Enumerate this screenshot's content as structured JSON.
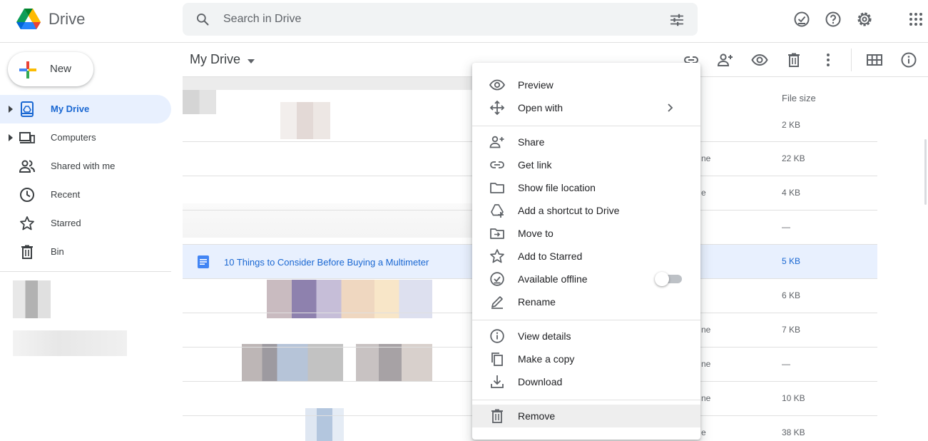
{
  "app": {
    "name": "Drive"
  },
  "search": {
    "placeholder": "Search in Drive"
  },
  "header_icons": [
    "offline-status-icon",
    "help-icon",
    "settings-icon",
    "apps-grid-icon"
  ],
  "sidebar": {
    "new_label": "New",
    "items": [
      {
        "label": "My Drive",
        "icon": "my-drive-icon",
        "active": true
      },
      {
        "label": "Computers",
        "icon": "computers-icon"
      },
      {
        "label": "Shared with me",
        "icon": "shared-icon"
      },
      {
        "label": "Recent",
        "icon": "clock-icon"
      },
      {
        "label": "Starred",
        "icon": "star-icon"
      },
      {
        "label": "Bin",
        "icon": "trash-icon"
      }
    ]
  },
  "main": {
    "breadcrumb": "My Drive",
    "toolbar_icons": [
      "link-icon",
      "add-person-icon",
      "preview-eye-icon",
      "trash-icon",
      "more-vert-icon",
      "grid-view-icon",
      "info-icon"
    ],
    "column_header": "File size",
    "selected_file": "10 Things to Consider Before Buying a Multimeter",
    "owner_fragments": [
      "ne",
      "e",
      "ne",
      "ne",
      "ne",
      "e"
    ],
    "file_sizes": [
      "2 KB",
      "22 KB",
      "4 KB",
      "—",
      "5 KB",
      "6 KB",
      "7 KB",
      "—",
      "10 KB",
      "38 KB"
    ]
  },
  "context_menu": {
    "groups": [
      [
        {
          "label": "Preview",
          "icon": "eye-icon"
        },
        {
          "label": "Open with",
          "icon": "move-arrows-icon",
          "submenu": true
        }
      ],
      [
        {
          "label": "Share",
          "icon": "add-person-icon"
        },
        {
          "label": "Get link",
          "icon": "link-icon"
        },
        {
          "label": "Show file location",
          "icon": "folder-icon"
        },
        {
          "label": "Add a shortcut to Drive",
          "icon": "drive-shortcut-icon"
        },
        {
          "label": "Move to",
          "icon": "move-to-folder-icon"
        },
        {
          "label": "Add to Starred",
          "icon": "star-icon"
        },
        {
          "label": "Available offline",
          "icon": "offline-check-icon",
          "toggle": false
        },
        {
          "label": "Rename",
          "icon": "pencil-icon"
        }
      ],
      [
        {
          "label": "View details",
          "icon": "info-icon"
        },
        {
          "label": "Make a copy",
          "icon": "copy-icon"
        },
        {
          "label": "Download",
          "icon": "download-icon"
        }
      ],
      [
        {
          "label": "Remove",
          "icon": "trash-icon",
          "hovered": true
        }
      ]
    ]
  },
  "colors": {
    "accent": "#1967d2",
    "selected_bg": "#e8f0fe",
    "hover_bg": "#eeeeee",
    "search_bg": "#f1f3f4"
  }
}
